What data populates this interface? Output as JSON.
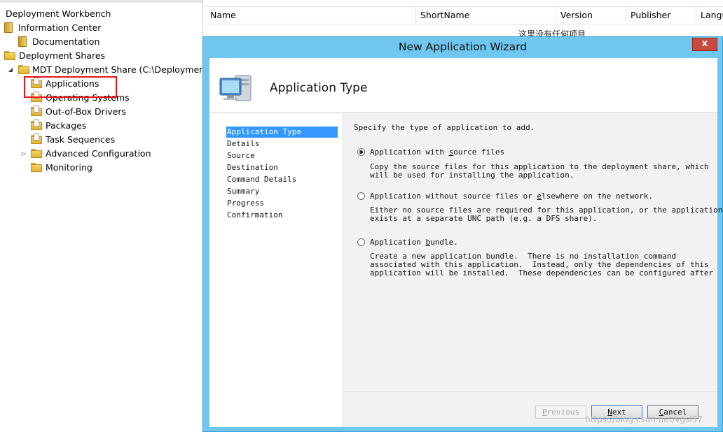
{
  "tree": {
    "root": "Deployment Workbench",
    "items": [
      {
        "label": "Information Center",
        "icon": "book-icon"
      },
      {
        "label": "Documentation",
        "icon": "book-icon"
      },
      {
        "label": "Deployment Shares",
        "icon": "folder-icon"
      },
      {
        "label": "MDT Deployment Share (C:\\DeploymentShare)",
        "icon": "folder-icon"
      },
      {
        "label": "Applications",
        "icon": "folder-icon",
        "selected": true
      },
      {
        "label": "Operating Systems",
        "icon": "folder-icon"
      },
      {
        "label": "Out-of-Box Drivers",
        "icon": "folder-icon"
      },
      {
        "label": "Packages",
        "icon": "folder-icon"
      },
      {
        "label": "Task Sequences",
        "icon": "folder-icon"
      },
      {
        "label": "Advanced Configuration",
        "icon": "folder-icon"
      },
      {
        "label": "Monitoring",
        "icon": "folder-icon"
      }
    ]
  },
  "list": {
    "columns": [
      "Name",
      "ShortName",
      "Version",
      "Publisher",
      "Langu"
    ],
    "empty_message": "这里没有任何项目"
  },
  "wizard": {
    "window_title": "New Application Wizard",
    "close_glyph": "x",
    "header_title": "Application Type",
    "steps": [
      "Application Type",
      "Details",
      "Source",
      "Destination",
      "Command Details",
      "Summary",
      "Progress",
      "Confirmation"
    ],
    "active_step": "Application Type",
    "prompt": "Specify the type of application to add.",
    "options": [
      {
        "pre": "Application with ",
        "key": "s",
        "post": "ource files",
        "selected": true,
        "description": "Copy the source files for this application to the deployment share, which\nwill be used for installing the application."
      },
      {
        "pre": "Application without source files or ",
        "key": "e",
        "post": "lsewhere on the network.",
        "selected": false,
        "description": "Either no source files are required for this application, or the application\nexists at a separate UNC path (e.g. a DFS share)."
      },
      {
        "pre": "Application ",
        "key": "b",
        "post": "undle.",
        "selected": false,
        "description": "Create a new application bundle.  There is no installation command\nassociated with this application.  Instead, only the dependencies of this\napplication will be installed.  These dependencies can be configured after"
      }
    ],
    "buttons": {
      "previous": {
        "key": "P",
        "rest": "revious",
        "enabled": false
      },
      "next": {
        "key": "N",
        "rest": "ext",
        "enabled": true
      },
      "cancel": {
        "key": "C",
        "rest": "ancel",
        "enabled": true
      }
    }
  },
  "watermark": "https://blog.csdn.net/vgsl37",
  "colors": {
    "title_bar": "#6fc6ee",
    "selection": "#3399ff",
    "highlight_box": "#e8141a",
    "close_button": "#c74b3f"
  }
}
